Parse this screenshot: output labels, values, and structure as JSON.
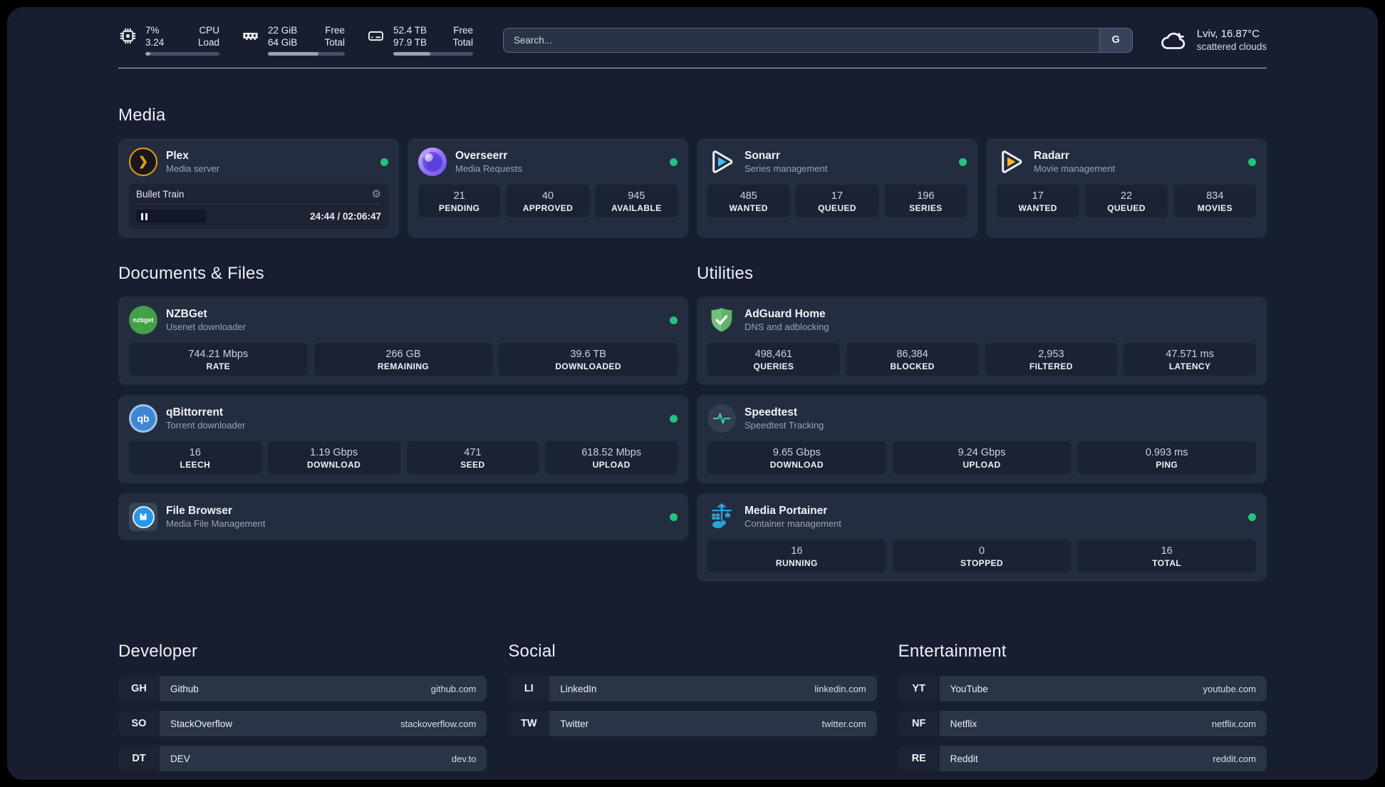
{
  "topbar": {
    "cpu": {
      "value_top": "7%",
      "value_bottom": "3.24",
      "label_top": "CPU",
      "label_bottom": "Load",
      "bar_style": "width:7%"
    },
    "ram": {
      "value_top": "22 GiB",
      "value_bottom": "64 GiB",
      "label_top": "Free",
      "label_bottom": "Total",
      "bar_style": "width:66%"
    },
    "disk": {
      "value_top": "52.4 TB",
      "value_bottom": "97.9 TB",
      "label_top": "Free",
      "label_bottom": "Total",
      "bar_style": "width:46%"
    },
    "search": {
      "placeholder": "Search...",
      "engine_label": "G"
    },
    "weather": {
      "location": "Lviv, 16.87°C",
      "condition": "scattered clouds"
    }
  },
  "media": {
    "heading": "Media",
    "plex": {
      "title": "Plex",
      "subtitle": "Media server",
      "icon_glyph": "❯",
      "now_playing": "Bullet Train",
      "time": "24:44 / 02:06:47"
    },
    "overseerr": {
      "title": "Overseerr",
      "subtitle": "Media Requests",
      "stats": [
        {
          "value": "21",
          "label": "PENDING"
        },
        {
          "value": "40",
          "label": "APPROVED"
        },
        {
          "value": "945",
          "label": "AVAILABLE"
        }
      ]
    },
    "sonarr": {
      "title": "Sonarr",
      "subtitle": "Series management",
      "stats": [
        {
          "value": "485",
          "label": "WANTED"
        },
        {
          "value": "17",
          "label": "QUEUED"
        },
        {
          "value": "196",
          "label": "SERIES"
        }
      ]
    },
    "radarr": {
      "title": "Radarr",
      "subtitle": "Movie management",
      "stats": [
        {
          "value": "17",
          "label": "WANTED"
        },
        {
          "value": "22",
          "label": "QUEUED"
        },
        {
          "value": "834",
          "label": "MOVIES"
        }
      ]
    }
  },
  "documents": {
    "heading": "Documents & Files",
    "nzbget": {
      "title": "NZBGet",
      "subtitle": "Usenet downloader",
      "icon_text": "nzbget",
      "stats": [
        {
          "value": "744.21 Mbps",
          "label": "RATE"
        },
        {
          "value": "266 GB",
          "label": "REMAINING"
        },
        {
          "value": "39.6 TB",
          "label": "DOWNLOADED"
        }
      ]
    },
    "qbittorrent": {
      "title": "qBittorrent",
      "subtitle": "Torrent downloader",
      "icon_text": "qb",
      "stats": [
        {
          "value": "16",
          "label": "LEECH"
        },
        {
          "value": "1.19 Gbps",
          "label": "DOWNLOAD"
        },
        {
          "value": "471",
          "label": "SEED"
        },
        {
          "value": "618.52 Mbps",
          "label": "UPLOAD"
        }
      ]
    },
    "filebrowser": {
      "title": "File Browser",
      "subtitle": "Media File Management"
    }
  },
  "utilities": {
    "heading": "Utilities",
    "adguard": {
      "title": "AdGuard Home",
      "subtitle": "DNS and adblocking",
      "stats": [
        {
          "value": "498,461",
          "label": "QUERIES"
        },
        {
          "value": "86,384",
          "label": "BLOCKED"
        },
        {
          "value": "2,953",
          "label": "FILTERED"
        },
        {
          "value": "47.571 ms",
          "label": "LATENCY"
        }
      ]
    },
    "speedtest": {
      "title": "Speedtest",
      "subtitle": "Speedtest Tracking",
      "stats": [
        {
          "value": "9.65 Gbps",
          "label": "DOWNLOAD"
        },
        {
          "value": "9.24 Gbps",
          "label": "UPLOAD"
        },
        {
          "value": "0.993 ms",
          "label": "PING"
        }
      ]
    },
    "portainer": {
      "title": "Media Portainer",
      "subtitle": "Container management",
      "stats": [
        {
          "value": "16",
          "label": "RUNNING"
        },
        {
          "value": "0",
          "label": "STOPPED"
        },
        {
          "value": "16",
          "label": "TOTAL"
        }
      ]
    }
  },
  "bookmarks": {
    "developer": {
      "heading": "Developer",
      "items": [
        {
          "abbr": "GH",
          "name": "Github",
          "url": "github.com"
        },
        {
          "abbr": "SO",
          "name": "StackOverflow",
          "url": "stackoverflow.com"
        },
        {
          "abbr": "DT",
          "name": "DEV",
          "url": "dev.to"
        }
      ]
    },
    "social": {
      "heading": "Social",
      "items": [
        {
          "abbr": "LI",
          "name": "LinkedIn",
          "url": "linkedin.com"
        },
        {
          "abbr": "TW",
          "name": "Twitter",
          "url": "twitter.com"
        }
      ]
    },
    "entertainment": {
      "heading": "Entertainment",
      "items": [
        {
          "abbr": "YT",
          "name": "YouTube",
          "url": "youtube.com"
        },
        {
          "abbr": "NF",
          "name": "Netflix",
          "url": "netflix.com"
        },
        {
          "abbr": "RE",
          "name": "Reddit",
          "url": "reddit.com"
        }
      ]
    }
  },
  "colors": {
    "status_online": "#21c47d",
    "plex_amber": "#e5a00d",
    "sonarr_blue": "#35c5f4",
    "radarr_yellow": "#ffb724",
    "nzbget_green": "#43a047",
    "qbittorrent_blue": "#3f87d3",
    "adguard_green": "#63b168",
    "speedtest_pulse": "#2dd4a0",
    "portainer_blue": "#26a5dd",
    "filebrowser_blue": "#2596e8",
    "overseerr_purple": "#7c5cf0"
  }
}
